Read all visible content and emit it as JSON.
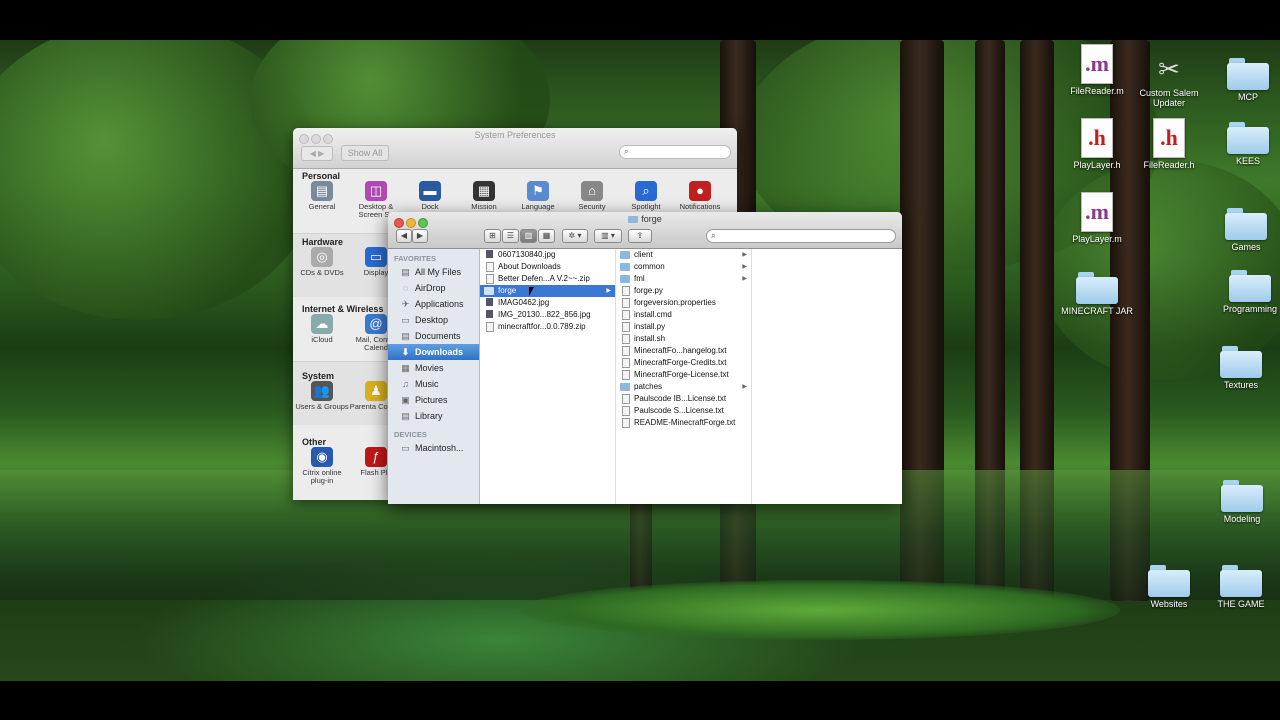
{
  "desktop_icons": [
    {
      "id": "filereader-m",
      "label": "FileReader.m",
      "type": "doc-m",
      "glyph": ".m"
    },
    {
      "id": "custom-salem",
      "label": "Custom Salem Updater",
      "type": "app",
      "glyph": "✂"
    },
    {
      "id": "mcp",
      "label": "MCP",
      "type": "folder"
    },
    {
      "id": "playlayer-h",
      "label": "PlayLayer.h",
      "type": "doc-h",
      "glyph": ".h"
    },
    {
      "id": "filereader-h",
      "label": "FileReader.h",
      "type": "doc-h",
      "glyph": ".h"
    },
    {
      "id": "kees",
      "label": "KEES",
      "type": "folder"
    },
    {
      "id": "playlayer-m",
      "label": "PlayLayer.m",
      "type": "doc-m",
      "glyph": ".m"
    },
    {
      "id": "games",
      "label": "Games",
      "type": "folder"
    },
    {
      "id": "minecraft-jar",
      "label": "MINECRAFT JAR",
      "type": "folder"
    },
    {
      "id": "programming",
      "label": "Programming",
      "type": "folder"
    },
    {
      "id": "textures",
      "label": "Textures",
      "type": "folder"
    },
    {
      "id": "modeling",
      "label": "Modeling",
      "type": "folder"
    },
    {
      "id": "websites",
      "label": "Websites",
      "type": "folder"
    },
    {
      "id": "the-game",
      "label": "THE GAME",
      "type": "folder"
    }
  ],
  "syspref": {
    "title": "System Preferences",
    "show_all": "Show All",
    "sections": {
      "personal": "Personal",
      "hardware": "Hardware",
      "internet": "Internet & Wireless",
      "system": "System",
      "other": "Other"
    },
    "personal_items": [
      {
        "label": "General",
        "glyph": "▤",
        "color": "#7a8a9a"
      },
      {
        "label": "Desktop & Screen Sa",
        "glyph": "◫",
        "color": "#b04ab0"
      },
      {
        "label": "Dock",
        "glyph": "▬",
        "color": "#2a5aa0"
      },
      {
        "label": "Mission",
        "glyph": "▦",
        "color": "#333"
      },
      {
        "label": "Language",
        "glyph": "⚑",
        "color": "#5a8ad0"
      },
      {
        "label": "Security",
        "glyph": "⌂",
        "color": "#888"
      },
      {
        "label": "Spotlight",
        "glyph": "⌕",
        "color": "#2a6ad0"
      },
      {
        "label": "Notifications",
        "glyph": "●",
        "color": "#c02020"
      }
    ],
    "hardware_items": [
      {
        "label": "CDs & DVDs",
        "glyph": "◎",
        "color": "#aaa"
      },
      {
        "label": "Display",
        "glyph": "▭",
        "color": "#2a6ad0"
      }
    ],
    "internet_items": [
      {
        "label": "iCloud",
        "glyph": "☁",
        "color": "#8aa"
      },
      {
        "label": "Mail, Cont & Calend",
        "glyph": "@",
        "color": "#3a7ad0"
      }
    ],
    "system_items": [
      {
        "label": "Users & Groups",
        "glyph": "👥",
        "color": "#555"
      },
      {
        "label": "Parenta Control",
        "glyph": "♟",
        "color": "#d8b020"
      }
    ],
    "other_items": [
      {
        "label": "Citrix online plug-in",
        "glyph": "◉",
        "color": "#2a5ab0"
      },
      {
        "label": "Flash Pla",
        "glyph": "ƒ",
        "color": "#c01818"
      }
    ]
  },
  "finder": {
    "title": "forge",
    "favorites_header": "FAVORITES",
    "devices_header": "DEVICES",
    "favorites": [
      {
        "label": "All My Files",
        "glyph": "▤"
      },
      {
        "label": "AirDrop",
        "glyph": "◌"
      },
      {
        "label": "Applications",
        "glyph": "✈"
      },
      {
        "label": "Desktop",
        "glyph": "▭"
      },
      {
        "label": "Documents",
        "glyph": "▤"
      },
      {
        "label": "Downloads",
        "glyph": "⬇",
        "selected": true
      },
      {
        "label": "Movies",
        "glyph": "▦"
      },
      {
        "label": "Music",
        "glyph": "♫"
      },
      {
        "label": "Pictures",
        "glyph": "▣"
      },
      {
        "label": "Library",
        "glyph": "▤"
      }
    ],
    "devices": [
      {
        "label": "Macintosh...",
        "glyph": "▭"
      }
    ],
    "column1": [
      {
        "name": "0607130840.jpg",
        "kind": "img"
      },
      {
        "name": "About Downloads",
        "kind": "file"
      },
      {
        "name": "Better Defen...A V.2~~.zip",
        "kind": "file"
      },
      {
        "name": "forge",
        "kind": "fold",
        "selected": true,
        "arrow": true
      },
      {
        "name": "IMAG0462.jpg",
        "kind": "img"
      },
      {
        "name": "IMG_20130...822_856.jpg",
        "kind": "img"
      },
      {
        "name": "minecraftfor...0.0.789.zip",
        "kind": "file"
      }
    ],
    "column2": [
      {
        "name": "client",
        "kind": "fold",
        "arrow": true
      },
      {
        "name": "common",
        "kind": "fold",
        "arrow": true
      },
      {
        "name": "fml",
        "kind": "fold",
        "arrow": true
      },
      {
        "name": "forge.py",
        "kind": "file"
      },
      {
        "name": "forgeversion.properties",
        "kind": "file"
      },
      {
        "name": "install.cmd",
        "kind": "file"
      },
      {
        "name": "install.py",
        "kind": "file"
      },
      {
        "name": "install.sh",
        "kind": "file"
      },
      {
        "name": "MinecraftFo...hangelog.txt",
        "kind": "file"
      },
      {
        "name": "MinecraftForge-Credits.txt",
        "kind": "file"
      },
      {
        "name": "MinecraftForge-License.txt",
        "kind": "file"
      },
      {
        "name": "patches",
        "kind": "fold",
        "arrow": true
      },
      {
        "name": "Paulscode IB...License.txt",
        "kind": "file"
      },
      {
        "name": "Paulscode S...License.txt",
        "kind": "file"
      },
      {
        "name": "README-MinecraftForge.txt",
        "kind": "file"
      }
    ]
  },
  "icons": {
    "back": "◀",
    "forward": "▶",
    "search": "⌕",
    "gear": "✲",
    "arrange": "▥",
    "share": "⇪",
    "view_icon": "⊞",
    "view_list": "☰",
    "view_column": "▥",
    "view_cover": "▦"
  }
}
